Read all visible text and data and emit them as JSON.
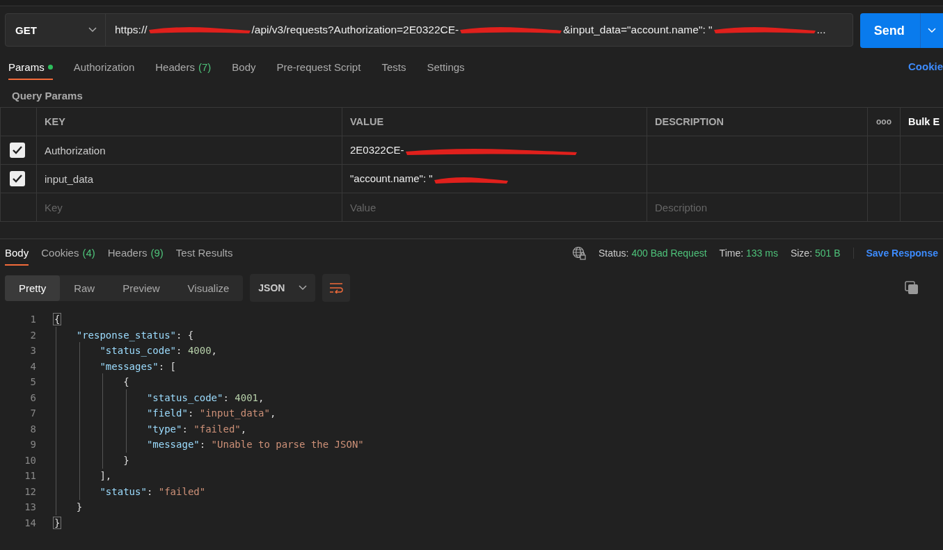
{
  "request": {
    "method": "GET",
    "url": [
      {
        "kind": "text",
        "text": "https://"
      },
      {
        "kind": "redacted"
      },
      {
        "kind": "text",
        "text": "/api/v3/requests?Authorization=2E0322CE-"
      },
      {
        "kind": "redacted"
      },
      {
        "kind": "text",
        "text": "&input_data=\"account.name\": \""
      },
      {
        "kind": "redacted"
      },
      {
        "kind": "text",
        "text": "..."
      }
    ],
    "send": "Send"
  },
  "request_tabs": [
    {
      "label": "Params",
      "dot": true,
      "selected": true
    },
    {
      "label": "Authorization",
      "dot": false,
      "selected": false
    },
    {
      "label": "Headers",
      "count": "(7)",
      "dot": false,
      "selected": false
    },
    {
      "label": "Body",
      "dot": false,
      "selected": false
    },
    {
      "label": "Pre-request Script",
      "dot": false,
      "selected": false
    },
    {
      "label": "Tests",
      "dot": false,
      "selected": false
    },
    {
      "label": "Settings",
      "dot": false,
      "selected": false
    }
  ],
  "cookies_link": "Cookie",
  "query_params": {
    "title": "Query Params",
    "columns": [
      "KEY",
      "VALUE",
      "DESCRIPTION"
    ],
    "more": "ooo",
    "bulk_edit": "Bulk E",
    "rows": [
      {
        "checked": true,
        "key": "Authorization",
        "value": "2E0322CE-"
      },
      {
        "checked": true,
        "key": "input_data",
        "value": "\"account.name\": \""
      }
    ],
    "new_row": {
      "key_placeholder": "Key",
      "value_placeholder": "Value",
      "description_placeholder": "Description"
    }
  },
  "response_tabs": [
    {
      "label": "Body",
      "selected": true
    },
    {
      "label": "Cookies",
      "count": "(4)",
      "selected": false
    },
    {
      "label": "Headers",
      "count": "(9)",
      "selected": false
    },
    {
      "label": "Test Results",
      "selected": false
    }
  ],
  "response_meta": [
    {
      "label": "Status:",
      "value": "400 Bad Request"
    },
    {
      "label": "Time:",
      "value": "133 ms"
    },
    {
      "label": "Size:",
      "value": "501 B"
    }
  ],
  "save_response": "Save Response",
  "view_modes": [
    {
      "label": "Pretty",
      "selected": true
    },
    {
      "label": "Raw",
      "selected": false
    },
    {
      "label": "Preview",
      "selected": false
    },
    {
      "label": "Visualize",
      "selected": false
    }
  ],
  "format": "JSON",
  "code": [
    {
      "number": "1",
      "tokens": [
        {
          "kind": "brace",
          "text": "{"
        }
      ]
    },
    {
      "number": "2",
      "tokens": [
        {
          "kind": "key",
          "text": "\"response_status\""
        },
        {
          "kind": "punct",
          "text": ": {"
        }
      ]
    },
    {
      "number": "3",
      "tokens": [
        {
          "kind": "key",
          "text": "\"status_code\""
        },
        {
          "kind": "punct",
          "text": ": "
        },
        {
          "kind": "number",
          "text": "4000"
        },
        {
          "kind": "punct",
          "text": ","
        }
      ]
    },
    {
      "number": "4",
      "tokens": [
        {
          "kind": "key",
          "text": "\"messages\""
        },
        {
          "kind": "punct",
          "text": ": ["
        }
      ]
    },
    {
      "number": "5",
      "tokens": [
        {
          "kind": "punct",
          "text": "{"
        }
      ]
    },
    {
      "number": "6",
      "tokens": [
        {
          "kind": "key",
          "text": "\"status_code\""
        },
        {
          "kind": "punct",
          "text": ": "
        },
        {
          "kind": "number",
          "text": "4001"
        },
        {
          "kind": "punct",
          "text": ","
        }
      ]
    },
    {
      "number": "7",
      "tokens": [
        {
          "kind": "key",
          "text": "\"field\""
        },
        {
          "kind": "punct",
          "text": ": "
        },
        {
          "kind": "string",
          "text": "\"input_data\""
        },
        {
          "kind": "punct",
          "text": ","
        }
      ]
    },
    {
      "number": "8",
      "tokens": [
        {
          "kind": "key",
          "text": "\"type\""
        },
        {
          "kind": "punct",
          "text": ": "
        },
        {
          "kind": "string",
          "text": "\"failed\""
        },
        {
          "kind": "punct",
          "text": ","
        }
      ]
    },
    {
      "number": "9",
      "tokens": [
        {
          "kind": "key",
          "text": "\"message\""
        },
        {
          "kind": "punct",
          "text": ": "
        },
        {
          "kind": "string",
          "text": "\"Unable to parse the JSON\""
        }
      ]
    },
    {
      "number": "10",
      "tokens": [
        {
          "kind": "punct",
          "text": "}"
        }
      ]
    },
    {
      "number": "11",
      "tokens": [
        {
          "kind": "punct",
          "text": "],"
        }
      ]
    },
    {
      "number": "12",
      "tokens": [
        {
          "kind": "key",
          "text": "\"status\""
        },
        {
          "kind": "punct",
          "text": ": "
        },
        {
          "kind": "string",
          "text": "\"failed\""
        }
      ]
    },
    {
      "number": "13",
      "tokens": [
        {
          "kind": "punct",
          "text": "}"
        }
      ]
    },
    {
      "number": "14",
      "tokens": [
        {
          "kind": "brace",
          "text": "}"
        }
      ]
    }
  ]
}
